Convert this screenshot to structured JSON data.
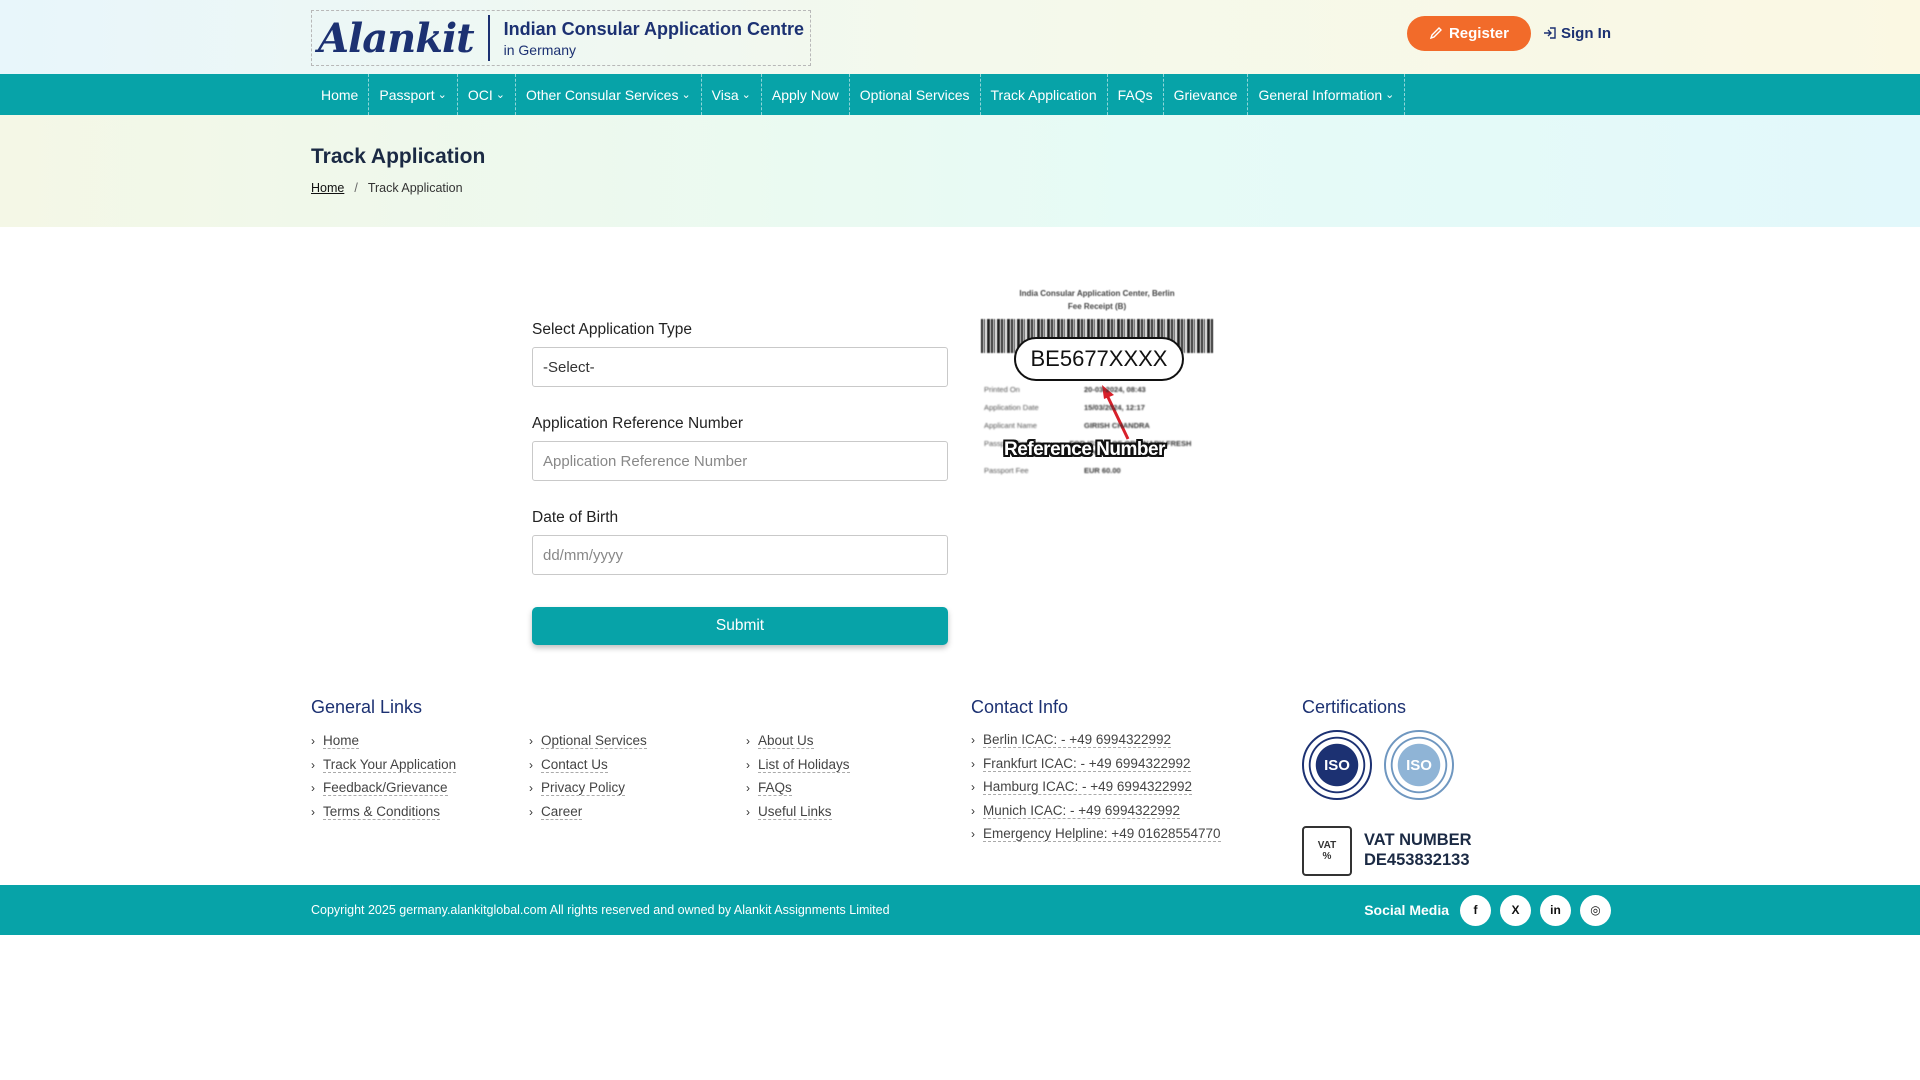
{
  "header": {
    "logo": "Alankit",
    "centre_line1": "Indian Consular Application Centre",
    "centre_line2": "in Germany",
    "register_label": "Register",
    "signin_label": "Sign In"
  },
  "nav": {
    "items": [
      {
        "label": "Home",
        "dropdown": false
      },
      {
        "label": "Passport",
        "dropdown": true
      },
      {
        "label": "OCI",
        "dropdown": true
      },
      {
        "label": "Other Consular Services",
        "dropdown": true
      },
      {
        "label": "Visa",
        "dropdown": true
      },
      {
        "label": "Apply Now",
        "dropdown": false
      },
      {
        "label": "Optional Services",
        "dropdown": false
      },
      {
        "label": "Track Application",
        "dropdown": false
      },
      {
        "label": "FAQs",
        "dropdown": false
      },
      {
        "label": "Grievance",
        "dropdown": false
      },
      {
        "label": "General Information",
        "dropdown": true
      }
    ]
  },
  "page": {
    "title": "Track Application",
    "breadcrumb": {
      "home": "Home",
      "sep": "/",
      "current": "Track Application"
    }
  },
  "form": {
    "type_label": "Select Application Type",
    "type_value": "-Select-",
    "ref_label": "Application Reference Number",
    "ref_placeholder": "Application Reference Number",
    "dob_label": "Date of Birth",
    "dob_placeholder": "dd/mm/yyyy",
    "submit_label": "Submit"
  },
  "receipt": {
    "title1": "India Consular Application Center, Berlin",
    "title2": "Fee Receipt (B)",
    "ref_example": "BE5677XXXX",
    "ref_caption": "Reference Number",
    "rows": [
      {
        "k": "Printed On",
        "v": "20-03-2024, 08:43"
      },
      {
        "k": "Application Date",
        "v": "15/03/2024, 12:17"
      },
      {
        "k": "Applicant Name",
        "v": "GIRISH CHANDRA"
      },
      {
        "k": "Passport Service",
        "v": "FOR ISSUE OF ORDINARY FRESH PASSPORT"
      },
      {
        "k": "Passport Fee",
        "v": "EUR 60.00"
      }
    ]
  },
  "footer": {
    "general_head": "General Links",
    "general_col1": [
      "Home",
      "Track Your Application",
      "Feedback/Grievance",
      "Terms & Conditions"
    ],
    "general_col2": [
      "Optional Services",
      "Contact Us",
      "Privacy Policy",
      "Career"
    ],
    "general_col3": [
      "About Us",
      "List of Holidays",
      "FAQs",
      "Useful Links"
    ],
    "contact_head": "Contact Info",
    "contact": [
      "Berlin ICAC: - +49 6994322992",
      "Frankfurt ICAC: - +49 6994322992",
      "Hamburg ICAC: - +49 6994322992",
      "Munich ICAC: - +49 6994322992",
      "Emergency Helpline: +49 01628554770"
    ],
    "cert_head": "Certifications",
    "cert1": "ISO",
    "cert2": "ISO",
    "vat_icon_text": "VAT",
    "vat_label": "VAT NUMBER",
    "vat_number": "DE453832133",
    "copyright": "Copyright 2025 germany.alankitglobal.com All rights reserved and owned by Alankit Assignments Limited",
    "social_label": "Social Media",
    "social": [
      "f",
      "X",
      "in",
      "◎"
    ]
  }
}
